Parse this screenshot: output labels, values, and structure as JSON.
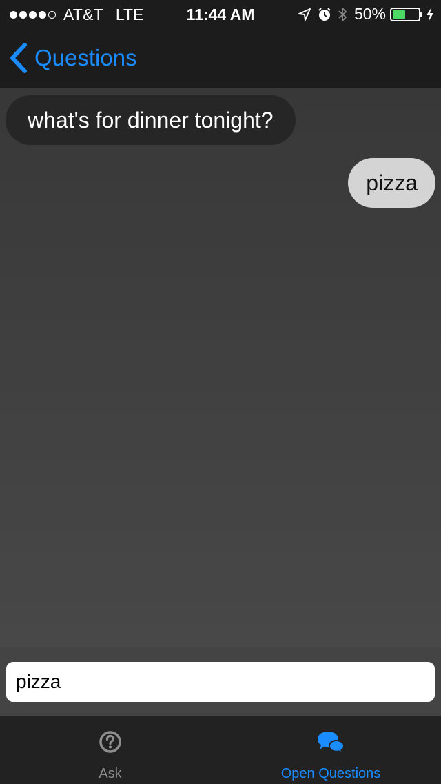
{
  "status_bar": {
    "carrier": "AT&T",
    "network": "LTE",
    "time": "11:44 AM",
    "battery_percent": "50%",
    "battery_level": 0.5,
    "signal_bars_filled": 4,
    "signal_bars_total": 5,
    "icons": [
      "location-arrow-icon",
      "alarm-icon",
      "bluetooth-icon",
      "battery-icon",
      "charging-bolt-icon"
    ]
  },
  "nav": {
    "back_label": "Questions",
    "back_icon": "chevron-left-icon"
  },
  "messages": [
    {
      "direction": "incoming",
      "text": "what's for dinner tonight?"
    },
    {
      "direction": "outgoing",
      "text": "pizza"
    }
  ],
  "composer": {
    "value": "pizza"
  },
  "tab_bar": {
    "tabs": [
      {
        "label": "Ask",
        "icon": "question-circle-icon",
        "selected": false
      },
      {
        "label": "Open Questions",
        "icon": "chat-bubbles-icon",
        "selected": true
      }
    ]
  },
  "colors": {
    "accent": "#1a8cff",
    "incoming_bubble": "#262626",
    "outgoing_bubble": "#d4d4d4",
    "battery_fill": "#4cd964"
  }
}
